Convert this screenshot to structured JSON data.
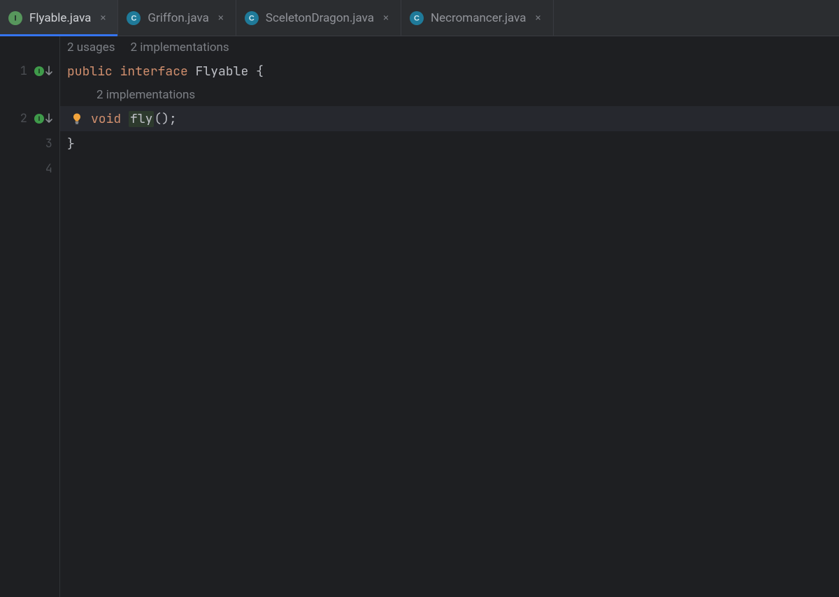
{
  "tabs": [
    {
      "label": "Flyable.java",
      "icon": "I",
      "kind": "interface",
      "active": true
    },
    {
      "label": "Griffon.java",
      "icon": "C",
      "kind": "class",
      "active": false
    },
    {
      "label": "SceletonDragon.java",
      "icon": "C",
      "kind": "class",
      "active": false
    },
    {
      "label": "Necromancer.java",
      "icon": "C",
      "kind": "class",
      "active": false
    }
  ],
  "hints": {
    "top": {
      "usages": "2 usages",
      "impls": "2 implementations"
    },
    "method": {
      "impls": "2 implementations"
    }
  },
  "lines": {
    "l1": "1",
    "l2": "2",
    "l3": "3",
    "l4": "4"
  },
  "code": {
    "kw_public": "public",
    "kw_interface": "interface",
    "name": "Flyable",
    "brace_open": "{",
    "kw_void": "void",
    "method": "fly",
    "after_method": "();",
    "brace_close": "}"
  },
  "icons": {
    "interface_letter": "I",
    "class_letter": "C"
  }
}
